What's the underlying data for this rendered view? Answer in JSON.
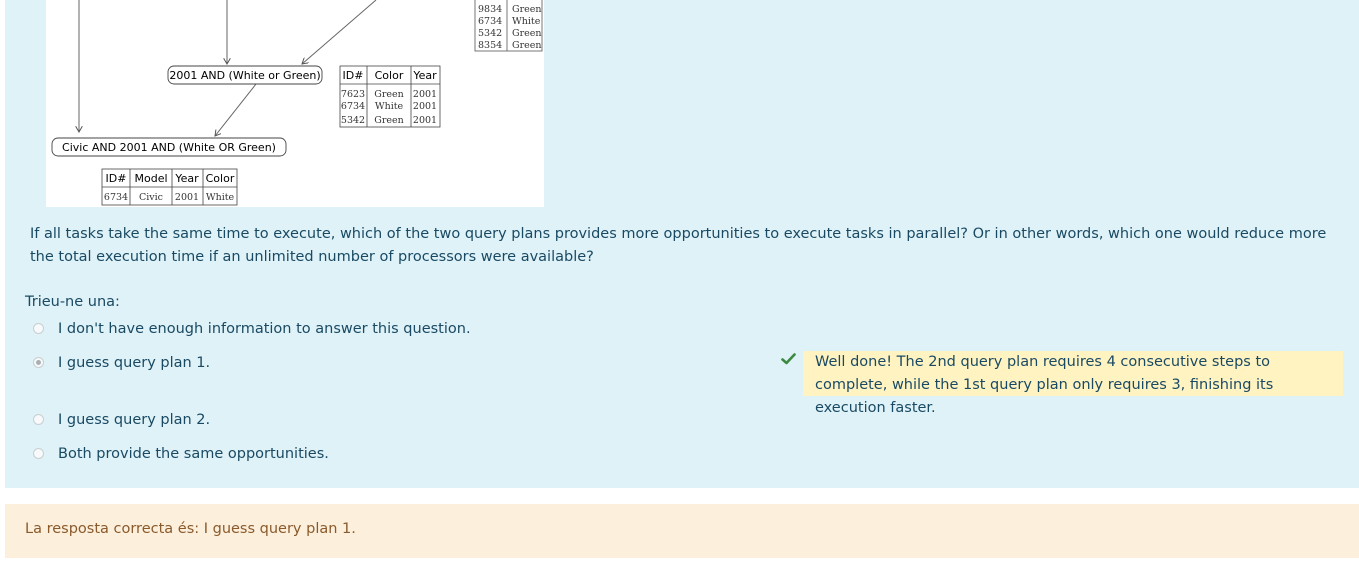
{
  "figure": {
    "top_table": {
      "rows": [
        [
          "9834",
          "Green"
        ],
        [
          "6734",
          "White"
        ],
        [
          "5342",
          "Green"
        ],
        [
          "8354",
          "Green"
        ]
      ]
    },
    "node_year_color": "2001 AND (White or Green)",
    "node_all": "Civic AND 2001 AND (White OR Green)",
    "table_year_color": {
      "headers": [
        "ID#",
        "Color",
        "Year"
      ],
      "rows": [
        [
          "7623",
          "Green",
          "2001"
        ],
        [
          "6734",
          "White",
          "2001"
        ],
        [
          "5342",
          "Green",
          "2001"
        ]
      ]
    },
    "table_all": {
      "headers": [
        "ID#",
        "Model",
        "Year",
        "Color"
      ],
      "rows": [
        [
          "6734",
          "Civic",
          "2001",
          "White"
        ]
      ]
    }
  },
  "question": {
    "text": "If all tasks take the same time to execute, which of the two query plans provides more opportunities to execute tasks in parallel? Or in other words, which one would reduce more the total execution time if an unlimited number of processors were available?",
    "prompt": "Trieu-ne una:",
    "options": [
      {
        "label": "I don't have enough information to answer this question.",
        "checked": false
      },
      {
        "label": "I guess query plan 1.",
        "checked": true
      },
      {
        "label": "I guess query plan 2.",
        "checked": false
      },
      {
        "label": "Both provide the same opportunities.",
        "checked": false
      }
    ],
    "feedback": "Well done! The 2nd query plan requires 4 consecutive steps to complete, while the 1st query plan only requires 3, finishing its execution faster."
  },
  "right_answer": "La resposta correcta és: I guess query plan 1.",
  "colors": {
    "question_bg": "#def2f8",
    "feedback_bg": "#fff3c2",
    "answer_bg": "#fcefdc",
    "check": "#3c8a3f"
  },
  "icons": {
    "check": "check-icon",
    "radio": "radio-icon"
  }
}
